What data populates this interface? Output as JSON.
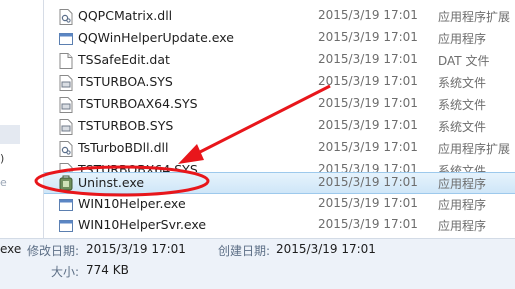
{
  "nav": {
    "fragment_1": ")",
    "fragment_2": "e"
  },
  "files": [
    {
      "name": "QQPCMatrix.dll",
      "date": "2015/3/19 17:01",
      "type": "应用程序扩展",
      "icon": "dll-icon"
    },
    {
      "name": "QQWinHelperUpdate.exe",
      "date": "2015/3/19 17:01",
      "type": "应用程序",
      "icon": "app-window-icon"
    },
    {
      "name": "TSSafeEdit.dat",
      "date": "2015/3/19 17:01",
      "type": "DAT 文件",
      "icon": "blank-file-icon"
    },
    {
      "name": "TSTURBOA.SYS",
      "date": "2015/3/19 17:01",
      "type": "系统文件",
      "icon": "system-file-icon"
    },
    {
      "name": "TSTURBOAX64.SYS",
      "date": "2015/3/19 17:01",
      "type": "系统文件",
      "icon": "system-file-icon"
    },
    {
      "name": "TSTURBOB.SYS",
      "date": "2015/3/19 17:01",
      "type": "系统文件",
      "icon": "system-file-icon"
    },
    {
      "name": "TsTurboBDll.dll",
      "date": "2015/3/19 17:01",
      "type": "应用程序扩展",
      "icon": "dll-icon"
    },
    {
      "name": "TSTURBOBX64.SYS",
      "date": "2015/3/19 17:01",
      "type": "系统文件",
      "icon": "system-file-icon"
    },
    {
      "name": "Uninst.exe",
      "date": "2015/3/19 17:01",
      "type": "应用程序",
      "icon": "uninstaller-icon"
    },
    {
      "name": "WIN10Helper.exe",
      "date": "2015/3/19 17:01",
      "type": "应用程序",
      "icon": "app-window-icon"
    },
    {
      "name": "WIN10HelperSvr.exe",
      "date": "2015/3/19 17:01",
      "type": "应用程序",
      "icon": "app-window-icon"
    }
  ],
  "details": {
    "ext_fragment": "exe",
    "modified_label": "修改日期:",
    "modified_value": "2015/3/19 17:01",
    "created_label": "创建日期:",
    "created_value": "2015/3/19 17:01",
    "size_label": "大小:",
    "size_value": "774 KB"
  },
  "annotation": {
    "color": "#e8161b",
    "target": "Uninst.exe"
  }
}
